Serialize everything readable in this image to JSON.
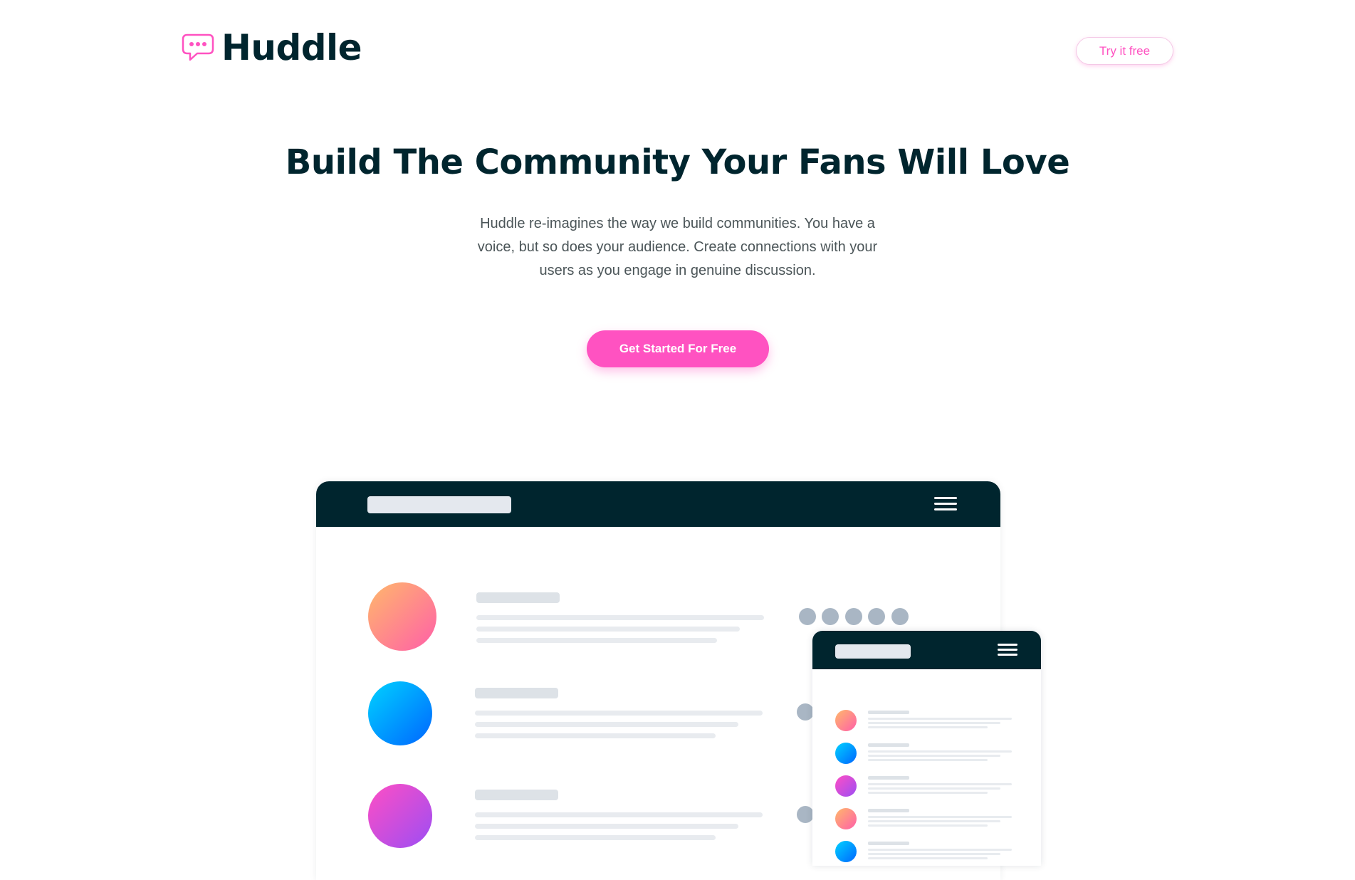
{
  "brand": {
    "name": "Huddle",
    "logo_icon": "chat-bubble-icon",
    "accent": "#ff52c1",
    "dark": "#00252e"
  },
  "header": {
    "cta_label": "Try it free"
  },
  "hero": {
    "title": "Build The Community Your Fans Will Love",
    "description": "Huddle re-imagines the way we build communities. You have a voice, but so does your audience. Create connections with your users as you engage in genuine discussion.",
    "cta_label": "Get Started For Free"
  },
  "mockup": {
    "desktop_menu_icon": "hamburger-icon",
    "mobile_menu_icon": "hamburger-icon",
    "colors": {
      "bar": "#00252e",
      "placeholder": "#e4e8ee",
      "dot": "#a9b6c4"
    }
  }
}
